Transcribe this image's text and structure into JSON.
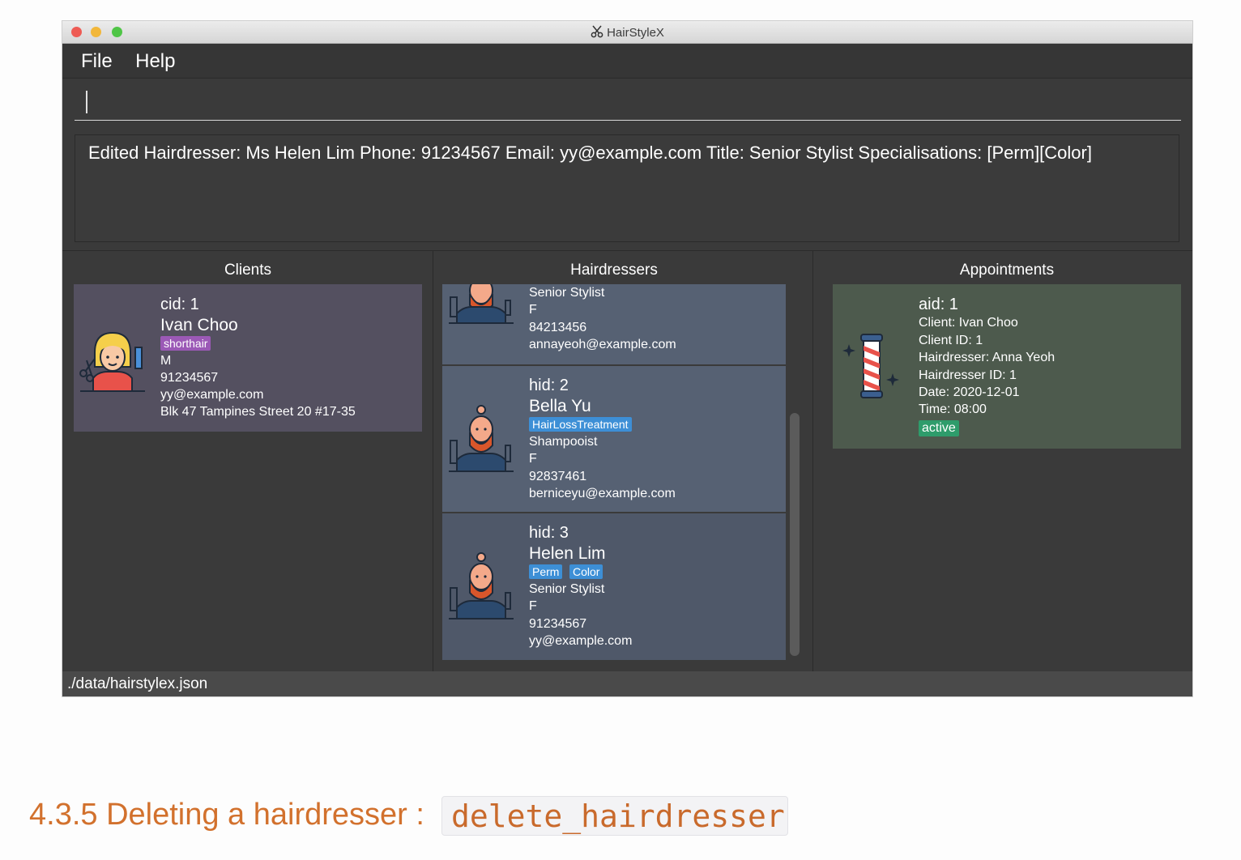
{
  "window": {
    "title": "HairStyleX"
  },
  "menu": {
    "file": "File",
    "help": "Help"
  },
  "command": {
    "value": ""
  },
  "result": {
    "text": "Edited Hairdresser: Ms Helen Lim Phone: 91234567 Email: yy@example.com Title: Senior Stylist Specialisations: [Perm][Color]"
  },
  "panels": {
    "clients": "Clients",
    "hairdressers": "Hairdressers",
    "appointments": "Appointments"
  },
  "clients": [
    {
      "id": "cid: 1",
      "name": "Ivan Choo",
      "tags": [
        "shorthair"
      ],
      "gender": "M",
      "phone": "91234567",
      "email": "yy@example.com",
      "address": "Blk 47 Tampines Street 20 #17-35"
    }
  ],
  "hairdressers": [
    {
      "title": "Senior Stylist",
      "gender": "F",
      "phone": "84213456",
      "email": "annayeoh@example.com"
    },
    {
      "id": "hid: 2",
      "name": "Bella Yu",
      "tags": [
        "HairLossTreatment"
      ],
      "title": "Shampooist",
      "gender": "F",
      "phone": "92837461",
      "email": "berniceyu@example.com"
    },
    {
      "id": "hid: 3",
      "name": "Helen Lim",
      "tags": [
        "Perm",
        "Color"
      ],
      "title": "Senior Stylist",
      "gender": "F",
      "phone": "91234567",
      "email": "yy@example.com"
    }
  ],
  "appointments": [
    {
      "id": "aid: 1",
      "client": "Client: Ivan Choo",
      "client_id": "Client ID: 1",
      "hairdresser": "Hairdresser: Anna Yeoh",
      "hairdresser_id": "Hairdresser ID: 1",
      "date": "Date: 2020-12-01",
      "time": "Time: 08:00",
      "status": "active"
    }
  ],
  "status": {
    "path": "./data/hairstylex.json"
  },
  "doc": {
    "heading": "4.3.5 Deleting a hairdresser : ",
    "code": "delete_hairdresser"
  },
  "colors": {
    "client_card": "#545060",
    "hairdresser_card": "#566173",
    "appointment_card": "#4d5a4d",
    "tag_purple": "#9b59b6",
    "tag_blue": "#3d8fd6",
    "tag_green": "#2e9c6b"
  },
  "icons": {
    "title": "scissors-icon",
    "client": "female-hairdresser-avatar-icon",
    "hairdresser": "bearded-man-avatar-icon",
    "appointment": "barber-pole-icon"
  }
}
